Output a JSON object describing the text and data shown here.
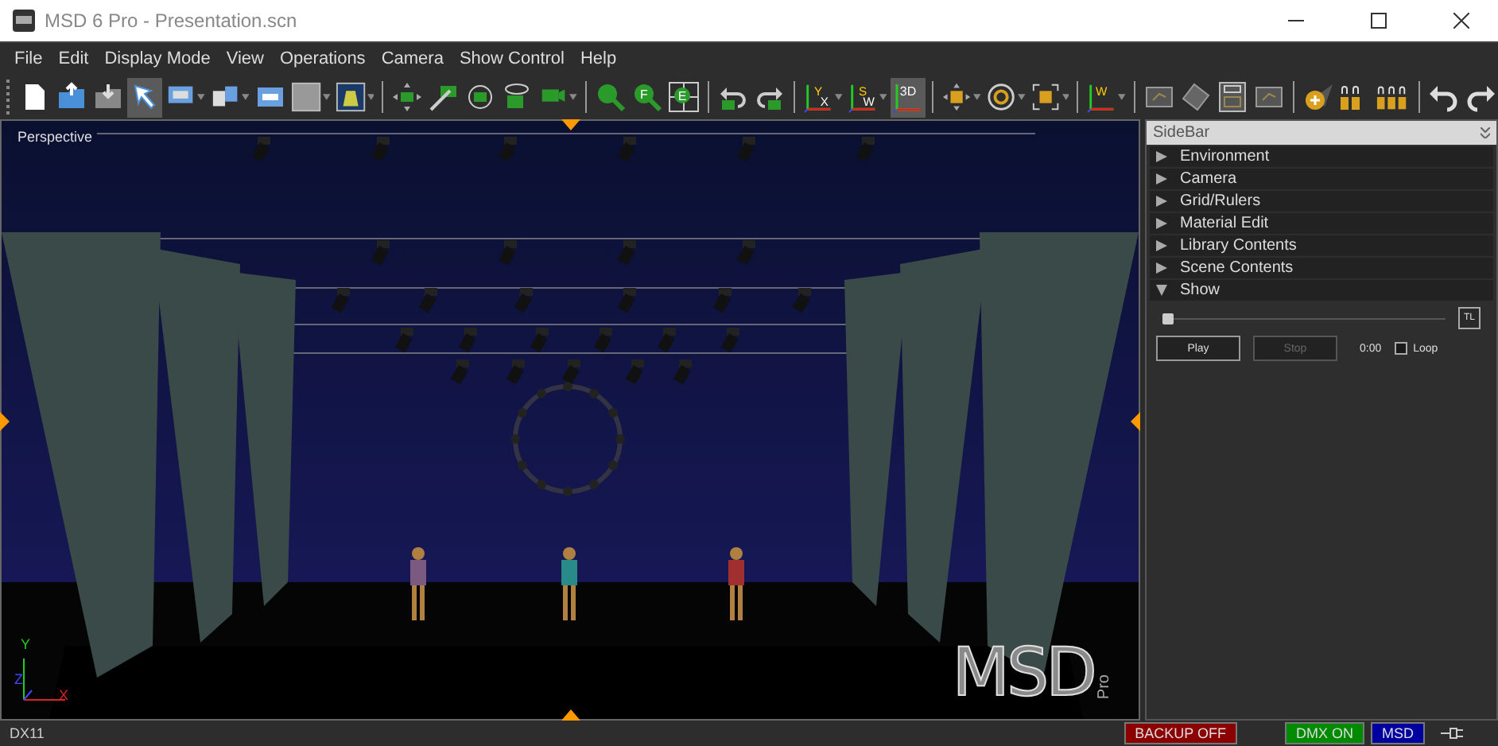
{
  "window": {
    "title": "MSD 6 Pro - Presentation.scn"
  },
  "menu": [
    "File",
    "Edit",
    "Display Mode",
    "View",
    "Operations",
    "Camera",
    "Show Control",
    "Help"
  ],
  "toolbar": [
    {
      "kind": "newfile",
      "selected": false
    },
    {
      "kind": "open",
      "selected": false
    },
    {
      "kind": "save",
      "selected": false
    },
    {
      "kind": "pointer",
      "selected": true
    },
    {
      "kind": "display",
      "selected": false,
      "dropdown": true
    },
    {
      "kind": "views",
      "selected": false,
      "dropdown": true
    },
    {
      "kind": "window",
      "selected": false
    },
    {
      "kind": "swatch",
      "selected": false,
      "dropdown": true
    },
    {
      "kind": "stage",
      "selected": false,
      "dropdown": true
    },
    {
      "kind": "separator"
    },
    {
      "kind": "pan",
      "selected": false
    },
    {
      "kind": "dolly",
      "selected": false
    },
    {
      "kind": "rotate",
      "selected": false
    },
    {
      "kind": "orbit",
      "selected": false
    },
    {
      "kind": "camera",
      "selected": false,
      "dropdown": true
    },
    {
      "kind": "separator"
    },
    {
      "kind": "zoom",
      "selected": false
    },
    {
      "kind": "zoomletter",
      "selected": false,
      "label": "F"
    },
    {
      "kind": "gridletter",
      "selected": false,
      "label": "E"
    },
    {
      "kind": "separator"
    },
    {
      "kind": "undocam",
      "selected": false
    },
    {
      "kind": "redocam",
      "selected": false
    },
    {
      "kind": "separator"
    },
    {
      "kind": "axis",
      "selected": false,
      "label": "Y",
      "sublabel": "X",
      "dropdown": true
    },
    {
      "kind": "axis",
      "selected": false,
      "label": "S",
      "sublabel": "W",
      "dropdown": true
    },
    {
      "kind": "axis",
      "selected": true,
      "label": "3D"
    },
    {
      "kind": "separator"
    },
    {
      "kind": "snapmove",
      "selected": false,
      "dropdown": true
    },
    {
      "kind": "snaprotate",
      "selected": false,
      "dropdown": true
    },
    {
      "kind": "snapscale",
      "selected": false,
      "dropdown": true
    },
    {
      "kind": "separator"
    },
    {
      "kind": "axis",
      "selected": false,
      "label": "W",
      "dropdown": true
    },
    {
      "kind": "separator"
    },
    {
      "kind": "plane",
      "selected": false
    },
    {
      "kind": "tilt",
      "selected": false
    },
    {
      "kind": "layout",
      "selected": false
    },
    {
      "kind": "plane",
      "selected": false
    },
    {
      "kind": "separator"
    },
    {
      "kind": "addlight",
      "selected": false
    },
    {
      "kind": "pair",
      "selected": false
    },
    {
      "kind": "triple",
      "selected": false
    },
    {
      "kind": "separator"
    },
    {
      "kind": "undo",
      "selected": false
    },
    {
      "kind": "redo",
      "selected": false
    }
  ],
  "viewport": {
    "label": "Perspective",
    "axes": {
      "y": "Y",
      "z": "Z",
      "x": "X"
    },
    "logo": {
      "main": "MSD",
      "sub": "Pro"
    }
  },
  "sidebar": {
    "title": "SideBar",
    "sections": [
      {
        "label": "Environment",
        "expanded": false
      },
      {
        "label": "Camera",
        "expanded": false
      },
      {
        "label": "Grid/Rulers",
        "expanded": false
      },
      {
        "label": "Material Edit",
        "expanded": false
      },
      {
        "label": "Library Contents",
        "expanded": false
      },
      {
        "label": "Scene Contents",
        "expanded": false
      },
      {
        "label": "Show",
        "expanded": true
      }
    ],
    "show": {
      "level": 0,
      "timeline_button": "TL",
      "play": {
        "label": "Play",
        "disabled": false
      },
      "stop": {
        "label": "Stop",
        "disabled": true
      },
      "time": "0:00",
      "loop": {
        "label": "Loop",
        "checked": false
      }
    }
  },
  "status_bar": {
    "renderer": "DX11",
    "badges": [
      {
        "label": "BACKUP OFF",
        "color": "#8b0000"
      },
      {
        "label": "DMX ON",
        "color": "#008a00"
      },
      {
        "label": "MSD",
        "color": "#0000a0"
      }
    ]
  }
}
